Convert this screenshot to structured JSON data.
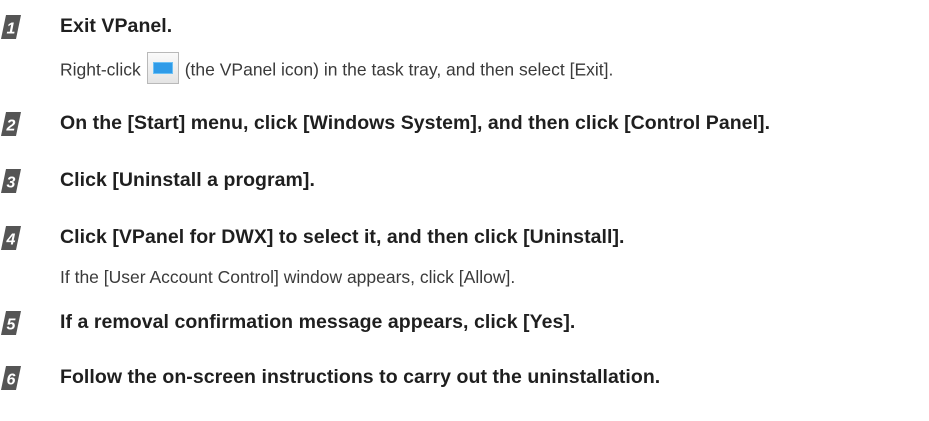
{
  "steps": [
    {
      "number": "1",
      "title": "Exit VPanel.",
      "detail_before_icon": "Right-click",
      "icon": "vpanel-icon",
      "detail_after_icon": "(the VPanel icon) in the task tray, and then select [Exit]."
    },
    {
      "number": "2",
      "title": "On the [Start] menu, click [Windows System], and then click [Control Panel]."
    },
    {
      "number": "3",
      "title": "Click [Uninstall a program]."
    },
    {
      "number": "4",
      "title": "Click [VPanel for DWX] to select it, and then click [Uninstall].",
      "detail": "If the [User Account Control] window appears, click [Allow]."
    },
    {
      "number": "5",
      "title": "If a removal confirmation message appears, click [Yes]."
    },
    {
      "number": "6",
      "title": "Follow the on-screen instructions to carry out the uninstallation."
    }
  ],
  "colors": {
    "text": "#1f1f1f",
    "badge": "#555555",
    "icon_accent": "#2f9be8"
  }
}
